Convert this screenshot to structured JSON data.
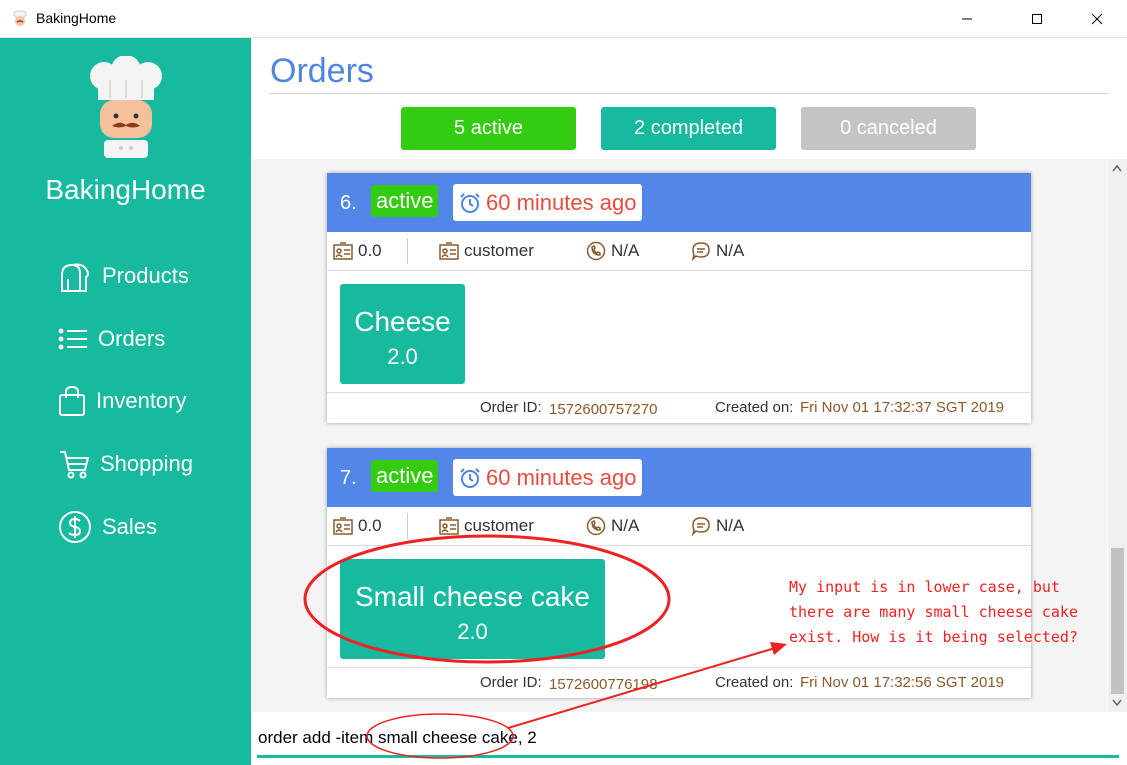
{
  "window": {
    "title": "BakingHome"
  },
  "sidebar": {
    "brand": "BakingHome",
    "items": [
      {
        "label": "Products",
        "icon": "bread-icon"
      },
      {
        "label": "Orders",
        "icon": "list-icon"
      },
      {
        "label": "Inventory",
        "icon": "bag-icon"
      },
      {
        "label": "Shopping",
        "icon": "cart-icon"
      },
      {
        "label": "Sales",
        "icon": "dollar-icon"
      }
    ]
  },
  "main": {
    "title": "Orders",
    "tabs": {
      "active": "5 active",
      "completed": "2 completed",
      "canceled": "0 canceled"
    },
    "orders": [
      {
        "number": "6.",
        "status": "active",
        "time": "60 minutes ago",
        "total": "0.0",
        "customer": "customer",
        "phone": "N/A",
        "note": "N/A",
        "items": [
          {
            "name": "Cheese",
            "qty": "2.0"
          }
        ],
        "order_id_label": "Order ID:",
        "order_id": "1572600757270",
        "created_label": "Created on:",
        "created": "Fri Nov 01 17:32:37 SGT 2019"
      },
      {
        "number": "7.",
        "status": "active",
        "time": "60 minutes ago",
        "total": "0.0",
        "customer": "customer",
        "phone": "N/A",
        "note": "N/A",
        "items": [
          {
            "name": "Small cheese cake",
            "qty": "2.0"
          }
        ],
        "order_id_label": "Order ID:",
        "order_id": "1572600776198",
        "created_label": "Created on:",
        "created": "Fri Nov 01 17:32:56 SGT 2019"
      }
    ],
    "command": {
      "value": "order add -item small cheese cake, 2"
    }
  },
  "annotation": {
    "text": "My input is in lower case, but\nthere are many small cheese cake\nexist. How is it being selected?"
  },
  "colors": {
    "sidebar": "#17b99f",
    "title": "#4d86e0",
    "active": "#33cc11",
    "completed": "#17b99f",
    "canceled": "#c4c4c4",
    "card_header": "#5287e8",
    "time_text": "#e74c3c",
    "annotation": "#ee2222"
  }
}
